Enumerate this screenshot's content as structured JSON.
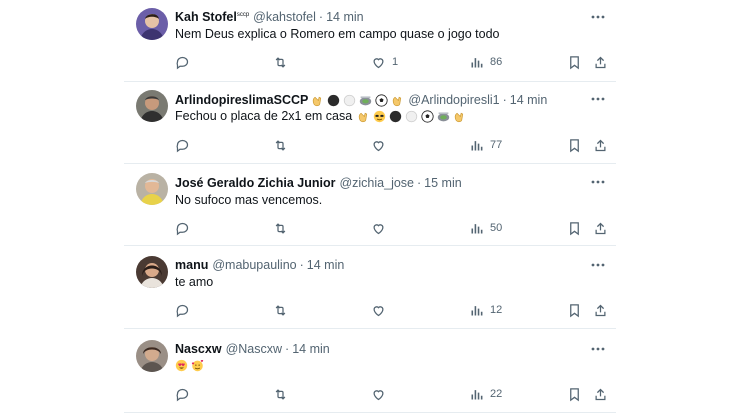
{
  "tweets": [
    {
      "name": "Kah Stofel",
      "name_sup": "sccp",
      "handle": "@kahstofel",
      "sep": "·",
      "time": "14 min",
      "text": "Nem Deus explica o Romero em campo quase o jogo todo",
      "avatar_color": "#6b5ea8",
      "counts": {
        "reply": "",
        "retweet": "",
        "like": "1",
        "views": "86"
      }
    },
    {
      "name": "ArlindopireslimaSCCP",
      "name_emojis": [
        "clap",
        "black-circle",
        "white-circle",
        "stadium",
        "soccer-ball",
        "clap"
      ],
      "handle": "@Arlindopiresli1",
      "sep": "·",
      "time": "14 min",
      "text": "Fechou o placa de 2x1 em casa",
      "text_emojis": [
        "clap",
        "sunglasses",
        "black-circle",
        "white-circle",
        "soccer-ball",
        "stadium",
        "clap"
      ],
      "avatar_color": "#7a7a72",
      "counts": {
        "reply": "",
        "retweet": "",
        "like": "",
        "views": "77"
      }
    },
    {
      "name": "José Geraldo Zichia Junior",
      "handle": "@zichia_jose",
      "sep": "·",
      "time": "15 min",
      "text": "No sufoco mas vencemos.",
      "avatar_color": "#b9b2a4",
      "counts": {
        "reply": "",
        "retweet": "",
        "like": "",
        "views": "50"
      }
    },
    {
      "name": "manu",
      "handle": "@mabupaulino",
      "sep": "·",
      "time": "14 min",
      "text": "te amo",
      "avatar_color": "#4a3a33",
      "counts": {
        "reply": "",
        "retweet": "",
        "like": "",
        "views": "12"
      }
    },
    {
      "name": "Nascxw",
      "handle": "@Nascxw",
      "sep": "·",
      "time": "14 min",
      "text": "",
      "text_emojis": [
        "heart-eyes",
        "smiling-hearts"
      ],
      "avatar_color": "#9a8f86",
      "counts": {
        "reply": "",
        "retweet": "",
        "like": "",
        "views": "22"
      }
    }
  ],
  "colors": {
    "text": "#0f1419",
    "secondary": "#536471",
    "border": "#e6ecf0"
  },
  "icons": [
    "reply-icon",
    "retweet-icon",
    "like-icon",
    "views-icon",
    "bookmark-icon",
    "share-icon",
    "more-icon"
  ]
}
